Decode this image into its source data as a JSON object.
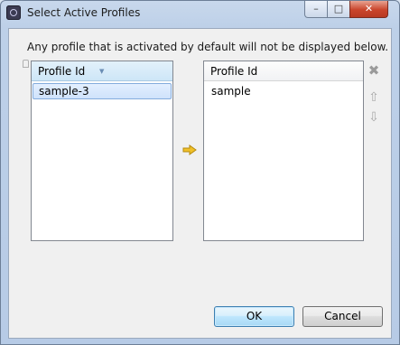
{
  "window": {
    "title": "Select Active Profiles",
    "icon": "app-icon",
    "minimize_glyph": "–",
    "maximize_glyph": "□",
    "close_glyph": "✕"
  },
  "description": "Any profile that is activated by default will not be displayed below.",
  "available_table": {
    "header": "Profile Id",
    "rows": [
      "sample-3"
    ],
    "selected_index": 0
  },
  "active_table": {
    "header": "Profile Id",
    "rows": [
      "sample"
    ]
  },
  "side_icons": {
    "remove": "remove-icon",
    "up": "arrow-up-icon",
    "down": "arrow-down-icon",
    "remove_glyph": "✖",
    "up_glyph": "⇧",
    "down_glyph": "⇩"
  },
  "move_icon": "arrow-right-icon",
  "buttons": {
    "ok": "OK",
    "cancel": "Cancel"
  },
  "colors": {
    "move_arrow": "#f0c028",
    "selection": "#cfe2fb",
    "default_button": "#3c7fb1"
  }
}
